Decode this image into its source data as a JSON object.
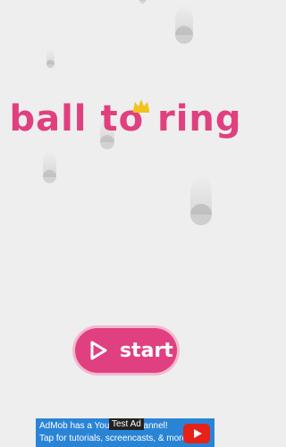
{
  "game": {
    "title": "ball to ring",
    "start_label": "start"
  },
  "ad": {
    "tag": "Test Ad",
    "line1": "AdMob has a YouTube Channel!",
    "line2": "Tap for tutorials, screencasts, & more."
  },
  "colors": {
    "brand": "#e0407f",
    "crown": "#f2c31d",
    "ad_background": "#2a84d6"
  }
}
